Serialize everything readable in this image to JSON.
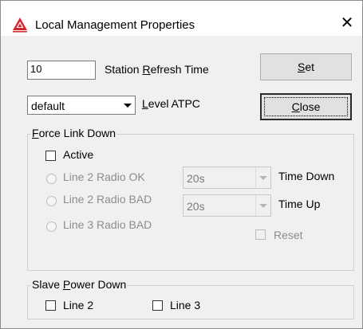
{
  "window": {
    "title": "Local Management Properties",
    "close_glyph": "✕",
    "icon": "warning-triangle-icon"
  },
  "station_refresh": {
    "value": "10",
    "label": "Station Refresh Time",
    "mnemonic": "R"
  },
  "level_atpc": {
    "value": "default",
    "label": "Level ATPC",
    "mnemonic": "L"
  },
  "buttons": {
    "set": "Set",
    "close": "Close"
  },
  "force_link_down": {
    "title": "Force Link Down",
    "active_label": "Active",
    "radios": [
      {
        "label": "Line 2 Radio OK"
      },
      {
        "label": "Line 2 Radio BAD"
      },
      {
        "label": "Line 3 Radio BAD"
      }
    ],
    "time_down": {
      "value": "20s",
      "label": "Time Down"
    },
    "time_up": {
      "value": "20s",
      "label": "Time Up"
    },
    "reset_label": "Reset"
  },
  "slave_power_down": {
    "title": "Slave Power Down",
    "line2_label": "Line 2",
    "line3_label": "Line 3"
  },
  "colors": {
    "icon_red": "#d9252a",
    "disabled_text": "#8d8d8d",
    "face": "#f0f0f0"
  }
}
